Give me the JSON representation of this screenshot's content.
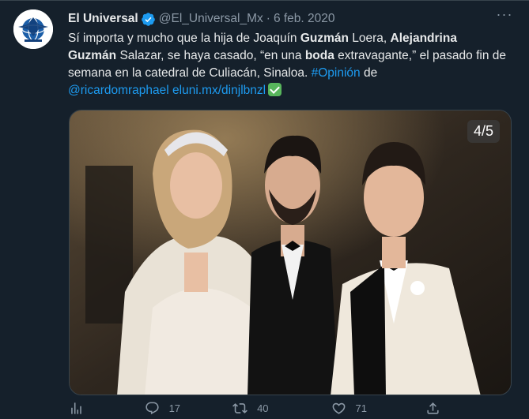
{
  "account": {
    "name": "El Universal",
    "handle": "@El_Universal_Mx",
    "separator": "·",
    "date": "6 feb. 2020"
  },
  "tweet": {
    "t1": "Sí importa y mucho que la hija de Joaquín ",
    "t2": "Guzmán",
    "t3": " Loera, ",
    "t4": "Alejandrina",
    "t5": "Guzmán",
    "t6": " Salazar, se haya casado, “en una ",
    "t7": "boda",
    "t8": " extravagante,” el pasado fin de semana en la catedral de Culiacán, Sinaloa. ",
    "hashtag": "#Opinión",
    "t9": " de",
    "link": "@ricardomraphael eluni.mx/dinjlbnzl"
  },
  "media": {
    "counter": "4/5"
  },
  "actions": {
    "replies": "17",
    "retweets": "40",
    "likes": "71"
  },
  "icons": [
    "verified-badge-icon",
    "more-icon",
    "analytics-icon",
    "reply-icon",
    "retweet-icon",
    "like-icon",
    "share-icon",
    "check-emoji-icon"
  ],
  "colors": {
    "background": "#15202b",
    "text": "#e7e9ea",
    "muted": "#8b98a5",
    "link": "#1d9bf0",
    "verified": "#1d9bf0"
  }
}
